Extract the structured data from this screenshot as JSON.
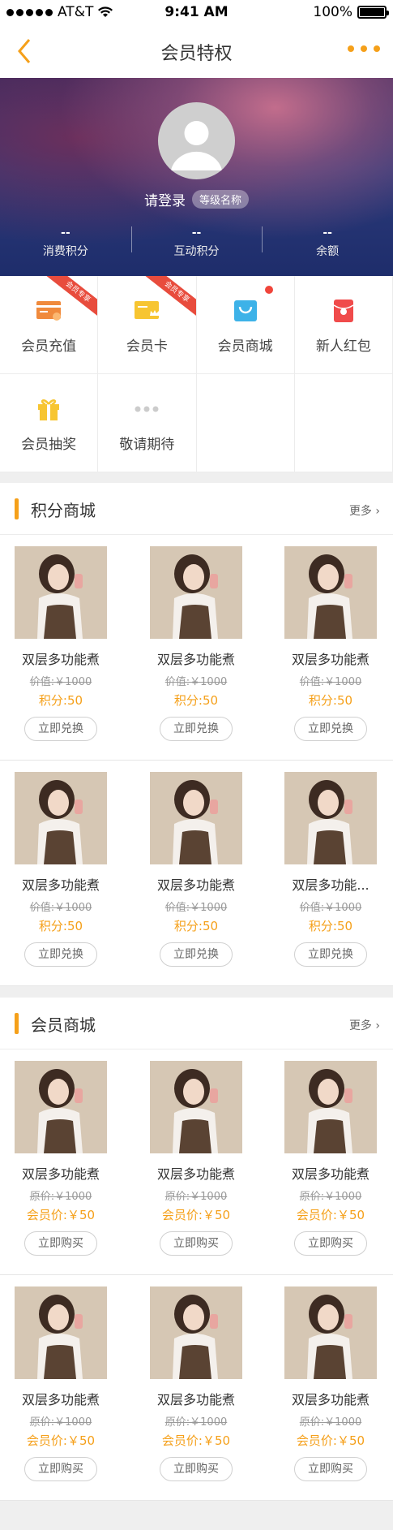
{
  "status_bar": {
    "carrier": "AT&T",
    "time": "9:41 AM",
    "battery": "100%"
  },
  "nav": {
    "title": "会员特权",
    "back_icon": "chevron-left-icon",
    "more_icon": "ellipsis-icon"
  },
  "profile": {
    "login": "请登录",
    "level": "等级名称",
    "stats": [
      {
        "value": "--",
        "label": "消费积分"
      },
      {
        "value": "--",
        "label": "互动积分"
      },
      {
        "value": "--",
        "label": "余额"
      }
    ]
  },
  "menu": [
    {
      "label": "会员充值",
      "icon": "recharge-card-icon",
      "ribbon": "会员专享"
    },
    {
      "label": "会员卡",
      "icon": "crown-card-icon",
      "ribbon": "会员专享"
    },
    {
      "label": "会员商城",
      "icon": "shopping-bag-icon",
      "dot": true
    },
    {
      "label": "新人红包",
      "icon": "red-envelope-icon"
    },
    {
      "label": "会员抽奖",
      "icon": "gift-icon"
    },
    {
      "label": "敬请期待",
      "icon": "more-dots-icon"
    }
  ],
  "points_mall": {
    "title": "积分商城",
    "more": "更多 ›",
    "items": [
      {
        "name": "双层多功能煮",
        "orig": "价值:￥1000",
        "price": "积分:50",
        "button": "立即兑换"
      },
      {
        "name": "双层多功能煮",
        "orig": "价值:￥1000",
        "price": "积分:50",
        "button": "立即兑换"
      },
      {
        "name": "双层多功能煮",
        "orig": "价值:￥1000",
        "price": "积分:50",
        "button": "立即兑换"
      },
      {
        "name": "双层多功能煮",
        "orig": "价值:￥1000",
        "price": "积分:50",
        "button": "立即兑换"
      },
      {
        "name": "双层多功能煮",
        "orig": "价值:￥1000",
        "price": "积分:50",
        "button": "立即兑换"
      },
      {
        "name": "双层多功能...",
        "orig": "价值:￥1000",
        "price": "积分:50",
        "button": "立即兑换"
      }
    ]
  },
  "member_mall": {
    "title": "会员商城",
    "more": "更多 ›",
    "items": [
      {
        "name": "双层多功能煮",
        "orig": "原价:￥1000",
        "price": "会员价:￥50",
        "button": "立即购买"
      },
      {
        "name": "双层多功能煮",
        "orig": "原价:￥1000",
        "price": "会员价:￥50",
        "button": "立即购买"
      },
      {
        "name": "双层多功能煮",
        "orig": "原价:￥1000",
        "price": "会员价:￥50",
        "button": "立即购买"
      },
      {
        "name": "双层多功能煮",
        "orig": "原价:￥1000",
        "price": "会员价:￥50",
        "button": "立即购买"
      },
      {
        "name": "双层多功能煮",
        "orig": "原价:￥1000",
        "price": "会员价:￥50",
        "button": "立即购买"
      },
      {
        "name": "双层多功能煮",
        "orig": "原价:￥1000",
        "price": "会员价:￥50",
        "button": "立即购买"
      }
    ]
  },
  "colors": {
    "accent": "#f5a01a",
    "ribbon": "#e84c3d",
    "mall_blue": "#3db2e8",
    "red_envelope": "#f04b4b"
  }
}
